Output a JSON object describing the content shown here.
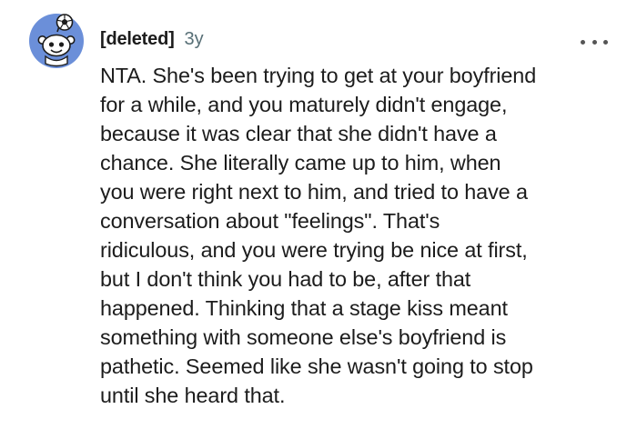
{
  "comment": {
    "author": "[deleted]",
    "age": "3y",
    "avatar_icon": "snoo-avatar-icon",
    "more_icon": "more-options-icon",
    "body": "NTA. She's been trying to get at your boyfriend\nfor a while, and you maturely didn't engage,\nbecause it was clear that she didn't have a\nchance. She literally came up to him, when\nyou were right next to him, and tried to have a\nconversation about \"feelings\". That's\nridiculous, and you were trying be nice at first,\nbut I don't think you had to be, after that\nhappened. Thinking that a stage kiss meant\nsomething with someone else's boyfriend is\npathetic. Seemed like she wasn't going to stop\nuntil she heard that."
  },
  "colors": {
    "avatar_bg": "#6b8fd9",
    "text": "#1c1c1c",
    "muted": "#576f76"
  }
}
